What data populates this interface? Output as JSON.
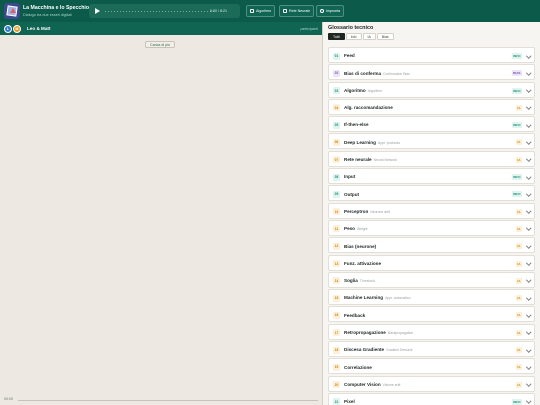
{
  "app": {
    "title": "La Macchina e lo Specchio",
    "subtitle": "Dialogo tra due esseri digitali"
  },
  "player": {
    "time": "0:00 / 8:21"
  },
  "toolbar": {
    "algorithm_label": "Algoritmo",
    "neural_label": "Rete Neurale",
    "learn_label": "Impronta"
  },
  "conversation": {
    "avatars": [
      "L",
      "M"
    ],
    "title": "Leo & Matt",
    "right_label": "partecipanti",
    "load_more": "Carica di più",
    "bottom_time": "00:00"
  },
  "glossary": {
    "title": "Glossario tecnico",
    "tabs": [
      "Tutti",
      "Info",
      "IA",
      "Bias"
    ],
    "active_tab": "Tutti",
    "items": [
      {
        "num": "01",
        "term": "Feed",
        "trans": "",
        "badge": "INFO",
        "kind": "info"
      },
      {
        "num": "02",
        "term": "Bias di conferma",
        "trans": "Confirmation Bias",
        "badge": "BIAS",
        "kind": "bias"
      },
      {
        "num": "03",
        "term": "Algoritmo",
        "trans": "Algorithm",
        "badge": "INFO",
        "kind": "info"
      },
      {
        "num": "04",
        "term": "Alg. raccomandazione",
        "trans": "",
        "badge": "IA",
        "kind": "ia"
      },
      {
        "num": "05",
        "term": "If-then-else",
        "trans": "",
        "badge": "INFO",
        "kind": "info"
      },
      {
        "num": "06",
        "term": "Deep Learning",
        "trans": "Appr. profondo",
        "badge": "IA",
        "kind": "ia"
      },
      {
        "num": "07",
        "term": "Rete neurale",
        "trans": "Neural Network",
        "badge": "IA",
        "kind": "ia"
      },
      {
        "num": "08",
        "term": "Input",
        "trans": "",
        "badge": "INFO",
        "kind": "info"
      },
      {
        "num": "09",
        "term": "Output",
        "trans": "",
        "badge": "INFO",
        "kind": "info"
      },
      {
        "num": "10",
        "term": "Perceptron",
        "trans": "Neurone artif.",
        "badge": "IA",
        "kind": "ia"
      },
      {
        "num": "11",
        "term": "Peso",
        "trans": "Weight",
        "badge": "IA",
        "kind": "ia"
      },
      {
        "num": "12",
        "term": "Bias (neurone)",
        "trans": "",
        "badge": "IA",
        "kind": "ia"
      },
      {
        "num": "13",
        "term": "Funz. attivazione",
        "trans": "",
        "badge": "IA",
        "kind": "ia"
      },
      {
        "num": "14",
        "term": "Soglia",
        "trans": "Threshold",
        "badge": "IA",
        "kind": "ia"
      },
      {
        "num": "15",
        "term": "Machine Learning",
        "trans": "Appr. automatico",
        "badge": "IA",
        "kind": "ia"
      },
      {
        "num": "16",
        "term": "Feedback",
        "trans": "",
        "badge": "IA",
        "kind": "ia"
      },
      {
        "num": "17",
        "term": "Retropropagazione",
        "trans": "Backpropagation",
        "badge": "IA",
        "kind": "ia"
      },
      {
        "num": "18",
        "term": "Discesa Gradiente",
        "trans": "Gradient Descent",
        "badge": "IA",
        "kind": "ia"
      },
      {
        "num": "19",
        "term": "Correlazione",
        "trans": "",
        "badge": "IA",
        "kind": "ia"
      },
      {
        "num": "20",
        "term": "Computer Vision",
        "trans": "Visione artif.",
        "badge": "IA",
        "kind": "ia"
      },
      {
        "num": "21",
        "term": "Pixel",
        "trans": "",
        "badge": "INFO",
        "kind": "info"
      }
    ]
  },
  "colors": {
    "header": "#0b5a4a",
    "info_bg": "#dff3ef",
    "info_fg": "#1f8f79",
    "bias_bg": "#ece4f7",
    "bias_fg": "#7a4fb5",
    "ia_bg": "#fdf0d9",
    "ia_fg": "#c98510",
    "avatar_l": "#2f7fd1",
    "avatar_m": "#e0a02b"
  }
}
